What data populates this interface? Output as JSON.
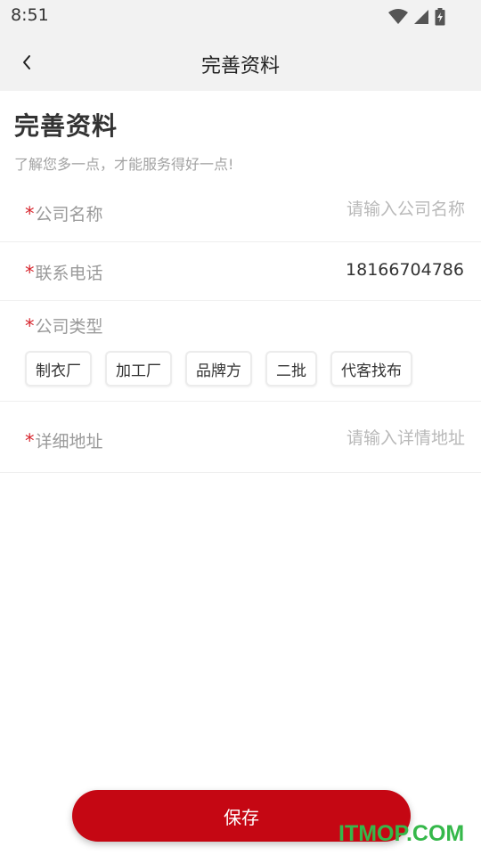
{
  "status_bar": {
    "time": "8:51"
  },
  "nav": {
    "title": "完善资料"
  },
  "header": {
    "title": "完善资料",
    "subtitle": "了解您多一点，才能服务得好一点!"
  },
  "required_mark": "*",
  "form": {
    "company_name": {
      "label": "公司名称",
      "placeholder": "请输入公司名称",
      "value": ""
    },
    "phone": {
      "label": "联系电话",
      "value": "18166704786"
    },
    "company_type": {
      "label": "公司类型",
      "options": [
        "制衣厂",
        "加工厂",
        "品牌方",
        "二批",
        "代客找布"
      ]
    },
    "address": {
      "label": "详细地址",
      "placeholder": "请输入详情地址",
      "value": ""
    }
  },
  "save_label": "保存",
  "watermark": "ITMOP.COM",
  "colors": {
    "accent": "#c50713",
    "required": "#d7262e",
    "watermark": "#35b84a"
  }
}
